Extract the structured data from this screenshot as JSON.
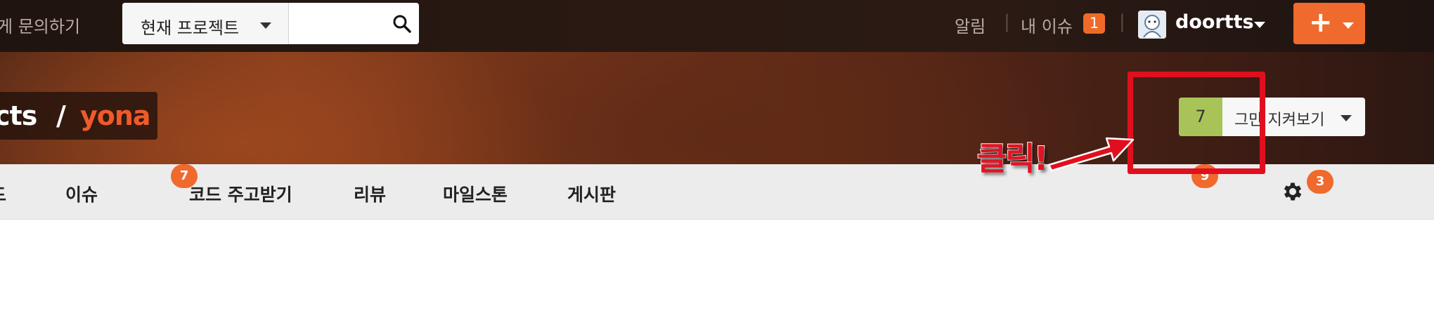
{
  "topbar": {
    "ask_link": "게 문의하기",
    "search": {
      "scope_label": "현재 프로젝트",
      "placeholder": ""
    },
    "alarm_label": "알림",
    "my_issue_label": "내 이슈",
    "my_issue_count": "1",
    "separator": "|",
    "user_name": "doortts",
    "new_button_label": "+"
  },
  "project": {
    "owner": "cts",
    "slash": "/",
    "name": "yona"
  },
  "watch": {
    "count": "7",
    "label": "그만 지켜보기"
  },
  "nav": {
    "prev_partial": "드",
    "items": [
      {
        "label": "이슈",
        "badge": "7"
      },
      {
        "label": "코드 주고받기"
      },
      {
        "label": "리뷰"
      },
      {
        "label": "마일스톤"
      },
      {
        "label": "게시판",
        "badge": "9"
      }
    ],
    "settings_badge": "3"
  },
  "annotation": {
    "click_text": "클릭!"
  },
  "colors": {
    "accent_orange": "#ef6a2c",
    "project_name": "#ef5a2c",
    "watch_count_bg": "#a8c458",
    "annotation_red": "#e10f1e"
  }
}
